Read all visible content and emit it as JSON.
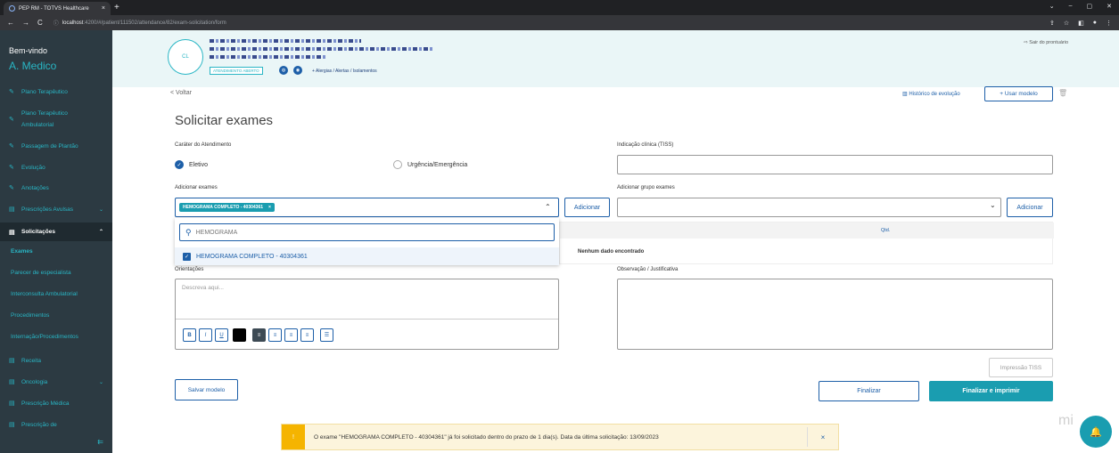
{
  "browser": {
    "tab_title": "PEP RM - TOTVS Healthcare",
    "tab_close": "×",
    "new_tab": "+",
    "url_host": "localhost",
    "url_path": ":4200/#/patient/111502/attendance/82/exam-solicitation/form",
    "back": "←",
    "forward": "→",
    "reload": "C",
    "info": "ⓘ",
    "win_controls": [
      "⌄",
      "–",
      "▢",
      "✕"
    ],
    "addr_icons": [
      "⇪",
      "☆",
      "◧",
      "●",
      "⋮"
    ]
  },
  "sidebar": {
    "welcome": "Bem-vindo",
    "user": "A. Medico",
    "collapse": "⇇",
    "items": [
      {
        "label": "Plano Terapêutico",
        "icon": "✎",
        "chevron": ""
      },
      {
        "label": "Plano Terapêutico Ambulatorial",
        "icon": "✎",
        "chevron": ""
      },
      {
        "label": "Passagem de Plantão",
        "icon": "✎",
        "chevron": ""
      },
      {
        "label": "Evolução",
        "icon": "✎",
        "chevron": ""
      },
      {
        "label": "Anotações",
        "icon": "✎",
        "chevron": ""
      },
      {
        "label": "Prescrições Avulsas",
        "icon": "▤",
        "chevron": "⌄"
      },
      {
        "label": "Solicitações",
        "icon": "▤",
        "chevron": "⌃"
      },
      {
        "label": "Receita",
        "icon": "▤",
        "chevron": ""
      },
      {
        "label": "Oncologia",
        "icon": "▤",
        "chevron": "⌄"
      },
      {
        "label": "Prescrição Médica",
        "icon": "▤",
        "chevron": ""
      },
      {
        "label": "Prescrição de",
        "icon": "▤",
        "chevron": ""
      }
    ],
    "subitems": [
      "Exames",
      "Parecer de especialista",
      "Interconsulta Ambulatorial",
      "Procedimentos",
      "Internação/Procedimentos"
    ]
  },
  "patient_header": {
    "avatar_initials": "CL",
    "status_badge": "ATENDIMENTO ABERTO",
    "alerts_link": "+ Alergias / Alertas / Isolamentos",
    "exit_link": "⇨ Sair do prontuário",
    "icon_a": "◍",
    "icon_b": "◉"
  },
  "main": {
    "back": "< Voltar",
    "history": "▥ Histórico de evolução",
    "use_model": "+ Usar modelo",
    "trash": "🗑",
    "title": "Solicitar exames",
    "carater_label": "Caráter do Atendimento",
    "radio_eletivo": "Eletivo",
    "radio_check": "✓",
    "radio_urgencia": "Urgência/Emergência",
    "indicacao_label": "Indicação clínica (TISS)",
    "adicionar_exames_label": "Adicionar exames",
    "selected_tag": "HEMOGRAMA COMPLETO - 40304361",
    "tag_remove": "×",
    "chevron_up": "⌃",
    "chevron_down": "⌄",
    "add_button": "Adicionar",
    "grupo_label": "Adicionar grupo exames",
    "add_group_button": "Adicionar",
    "search_value": "HEMOGRAMA",
    "search_icon": "⚲",
    "option_label": "HEMOGRAMA COMPLETO - 40304361",
    "option_check": "✓",
    "qtd_header": "Qtd.",
    "no_data": "Nenhum dado encontrado",
    "orientacoes_label": "Orientações",
    "orientacoes_placeholder": "Descreva aqui...",
    "observacao_label": "Observação / Justificativa",
    "toolbar": [
      "B",
      "I",
      "U",
      "",
      "≡",
      "≡",
      "≡",
      "≡",
      "☰"
    ],
    "print_tiss": "Impressão TISS",
    "save_model": "Salvar modelo",
    "finalize": "Finalizar",
    "finalize_print": "Finalizar e imprimir"
  },
  "toast": {
    "icon": "!",
    "message": "O exame \"HEMOGRAMA COMPLETO - 40304361\" já foi solicitado dentro do prazo de 1 dia(s). Data da última solicitação: 13/09/2023",
    "close": "×"
  },
  "brand_partial": "mi",
  "fab_icon": "🔔",
  "colors": {
    "accent": "#1a9db0",
    "primary": "#1d5fa8",
    "sidebar_bg": "#2c3a42",
    "warning": "#f5b400"
  }
}
